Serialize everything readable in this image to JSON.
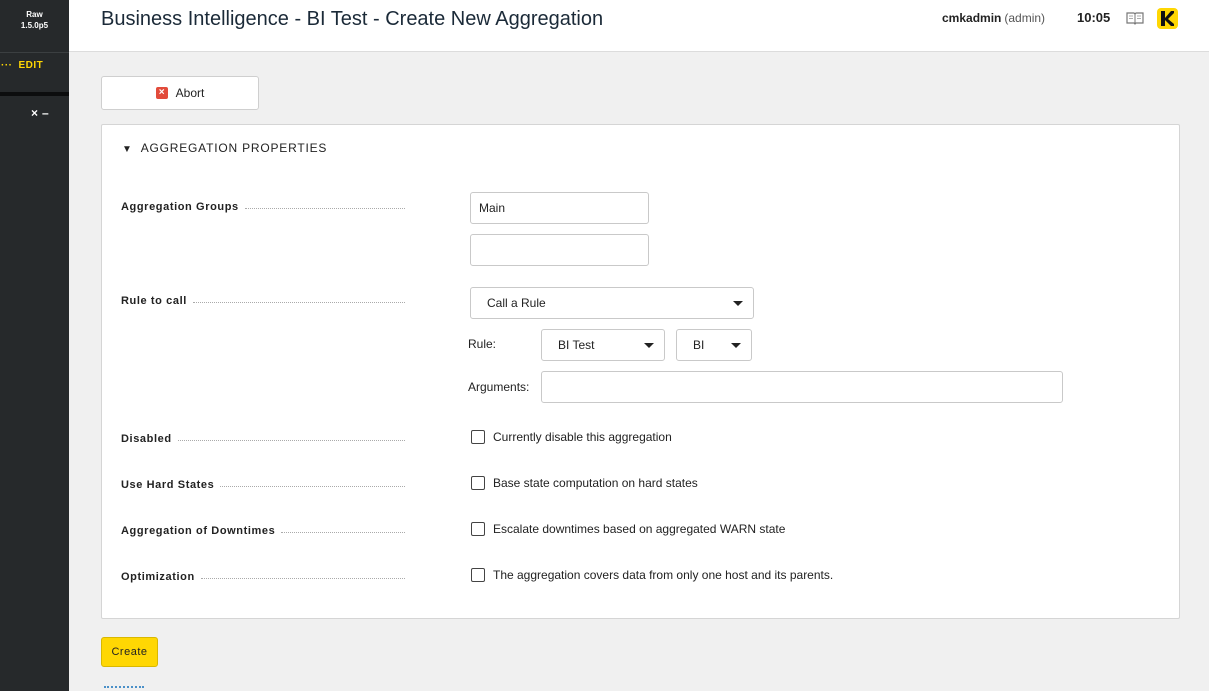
{
  "sidebar": {
    "edition": "Raw",
    "version": "1.5.0p5",
    "edit_label": "EDIT",
    "edit_dots": "···",
    "close_glyph": "×",
    "minimize_glyph": "–"
  },
  "header": {
    "title": "Business Intelligence - BI Test - Create New Aggregation",
    "user": "cmkadmin",
    "role": "(admin)",
    "time": "10:05"
  },
  "toolbar": {
    "abort_label": "Abort"
  },
  "section": {
    "title": "AGGREGATION PROPERTIES"
  },
  "form": {
    "aggregation_groups": {
      "label": "Aggregation Groups",
      "values": [
        "Main",
        ""
      ]
    },
    "rule_to_call": {
      "label": "Rule to call",
      "mode": "Call a Rule",
      "rule_label": "Rule:",
      "rule_value": "BI Test",
      "pack_value": "BI",
      "arguments_label": "Arguments:",
      "arguments_value": ""
    },
    "disabled": {
      "label": "Disabled",
      "checkbox_text": "Currently disable this aggregation",
      "checked": false
    },
    "hard_states": {
      "label": "Use Hard States",
      "checkbox_text": "Base state computation on hard states",
      "checked": false
    },
    "downtimes": {
      "label": "Aggregation of Downtimes",
      "checkbox_text": "Escalate downtimes based on aggregated WARN state",
      "checked": false
    },
    "optimization": {
      "label": "Optimization",
      "checkbox_text": "The aggregation covers data from only one host and its parents.",
      "checked": false
    }
  },
  "actions": {
    "create_label": "Create"
  },
  "colors": {
    "accent": "#ffd703",
    "sidebar": "#26292b",
    "abort_icon": "#e24b3b"
  }
}
